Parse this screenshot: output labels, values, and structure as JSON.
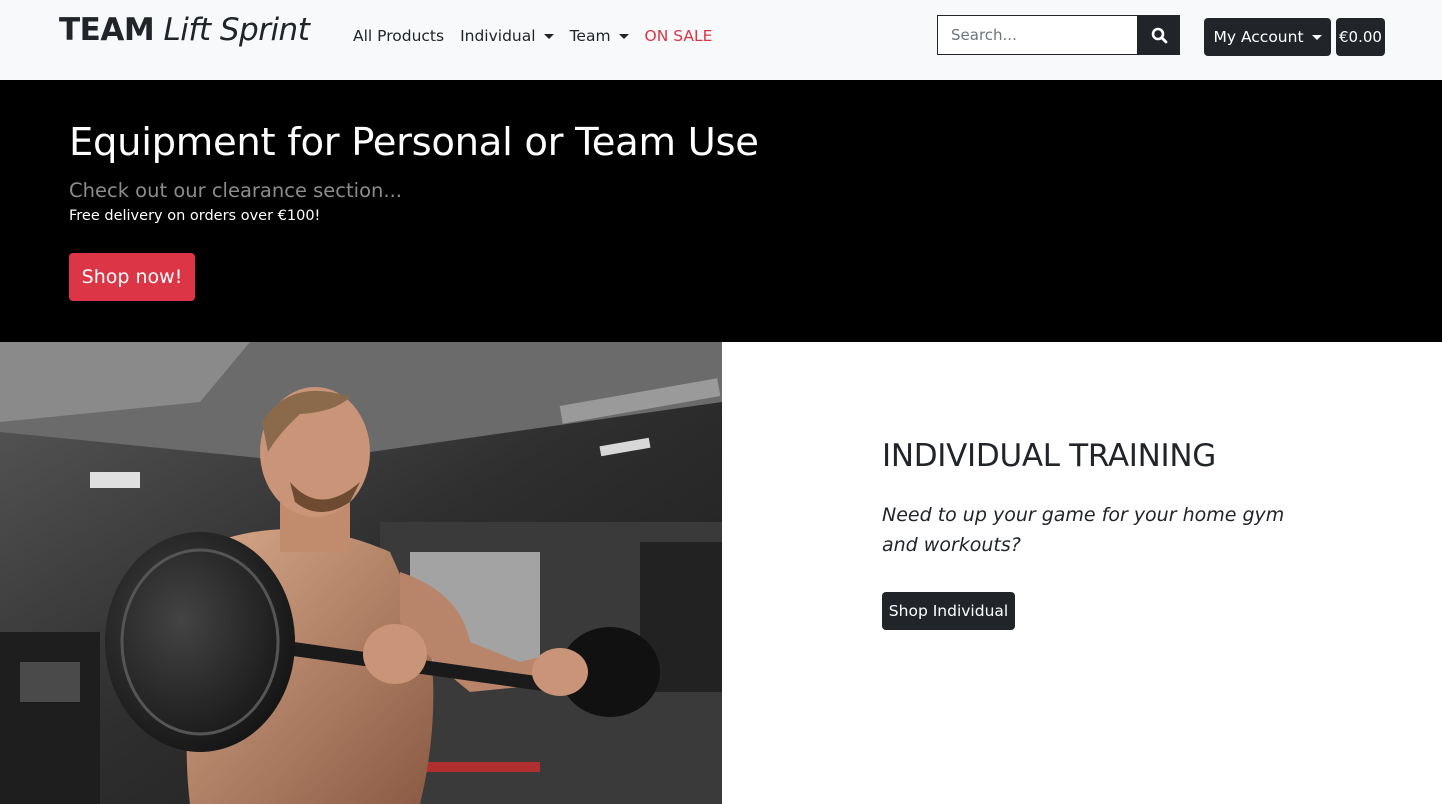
{
  "brand": {
    "part1": "TEAM",
    "part2": "Lift Sprint"
  },
  "nav": {
    "all_products": "All Products",
    "individual": "Individual",
    "team": "Team",
    "on_sale": "ON SALE"
  },
  "search": {
    "placeholder": "Search...",
    "icon": "search-icon"
  },
  "account": {
    "label": "My Account",
    "cart_total": "€0.00"
  },
  "hero": {
    "title": "Equipment for Personal or Team Use",
    "subtitle": "Check out our clearance section...",
    "note": "Free delivery on orders over €100!",
    "cta": "Shop now!"
  },
  "individual": {
    "title": "INDIVIDUAL TRAINING",
    "text": "Need to up your game for your home gym and workouts?",
    "cta": "Shop Individual"
  },
  "colors": {
    "navbar_bg": "#f8f9fa",
    "dark": "#212529",
    "sale_red": "#dc3545",
    "hero_bg": "#000000"
  }
}
